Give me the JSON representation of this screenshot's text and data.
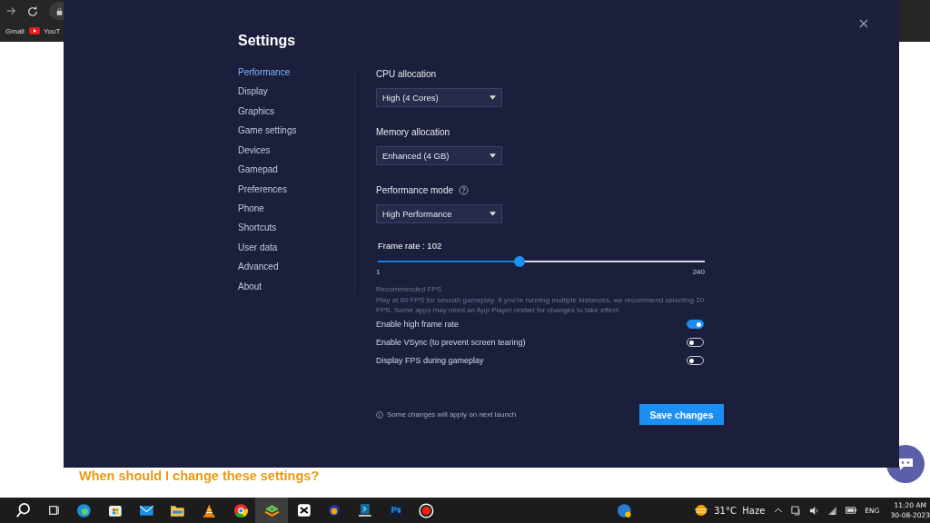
{
  "browser": {
    "bookmarks": [
      "Gmail",
      "YouT"
    ]
  },
  "settings": {
    "title": "Settings",
    "nav": [
      {
        "label": "Performance",
        "selected": true
      },
      {
        "label": "Display",
        "selected": false
      },
      {
        "label": "Graphics",
        "selected": false
      },
      {
        "label": "Game settings",
        "selected": false
      },
      {
        "label": "Devices",
        "selected": false
      },
      {
        "label": "Gamepad",
        "selected": false
      },
      {
        "label": "Preferences",
        "selected": false
      },
      {
        "label": "Phone",
        "selected": false
      },
      {
        "label": "Shortcuts",
        "selected": false
      },
      {
        "label": "User data",
        "selected": false
      },
      {
        "label": "Advanced",
        "selected": false
      },
      {
        "label": "About",
        "selected": false
      }
    ],
    "dropdowns": [
      {
        "label": "CPU allocation",
        "value": "High (4 Cores)",
        "help": false
      },
      {
        "label": "Memory allocation",
        "value": "Enhanced (4 GB)",
        "help": false
      },
      {
        "label": "Performance mode",
        "value": "High Performance",
        "help": true
      }
    ],
    "frame_rate": {
      "label": "Frame rate : 102",
      "level": 0.42,
      "min": "1",
      "max": "240"
    },
    "recommended": {
      "title": "Recommended FPS",
      "text": "Play at 60 FPS for smooth gameplay. If you're running multiple instances, we recommend selecting 20 FPS. Some apps may need an App Player restart for changes to take effect."
    },
    "toggles": [
      {
        "label": "Enable high frame rate",
        "on": true
      },
      {
        "label": "Enable VSync (to prevent screen tearing)",
        "on": false
      },
      {
        "label": "Display FPS during gameplay",
        "on": false
      }
    ],
    "note": "Some changes will apply on next launch",
    "save": "Save changes"
  },
  "page": {
    "heading": "When should I change these settings?"
  },
  "taskbar": {
    "weather": "31°C  Haze",
    "language": "ENG",
    "time": "11:20 AM",
    "date": "30-08-2023"
  }
}
